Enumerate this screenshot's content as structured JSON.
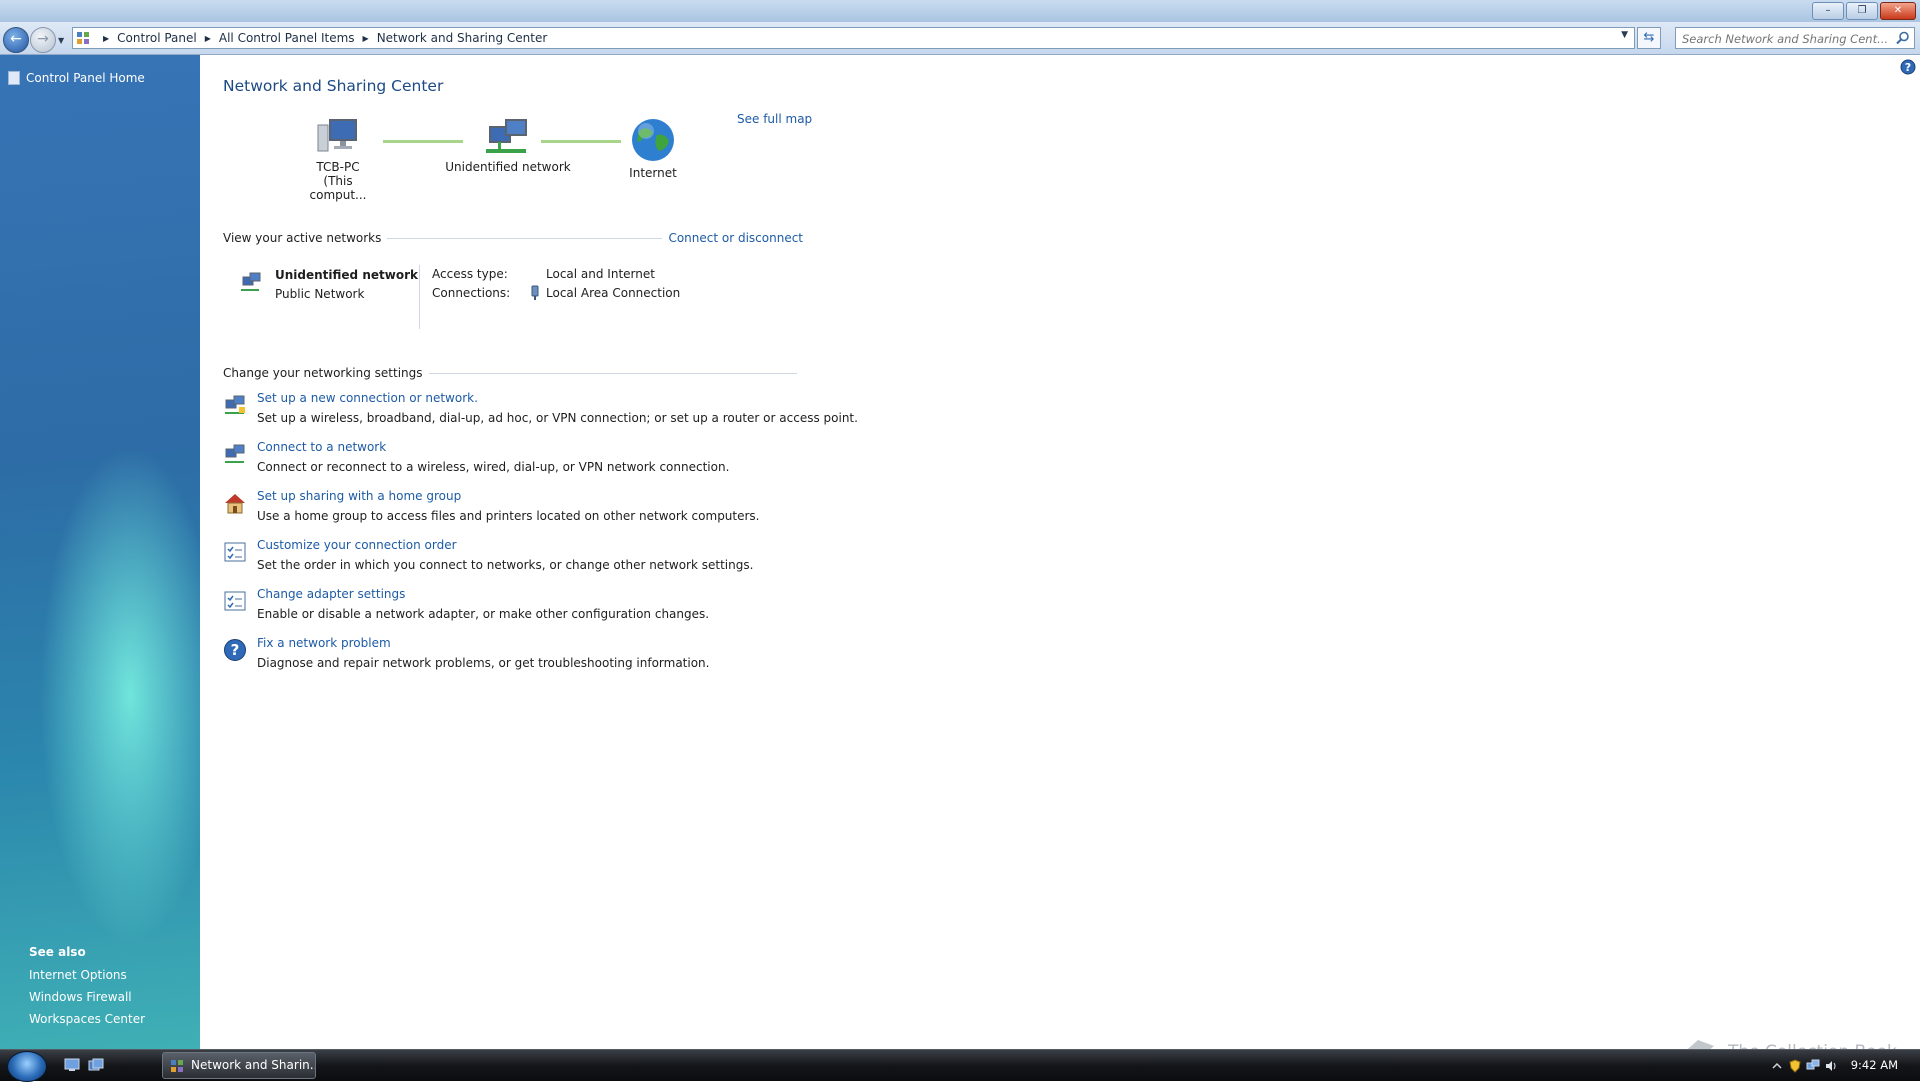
{
  "window": {
    "controls": {
      "minimize": "–",
      "maximize": "❐",
      "close": "✕"
    }
  },
  "navigation": {
    "back_glyph": "←",
    "forward_glyph": "→",
    "breadcrumbs": [
      "Control Panel",
      "All Control Panel Items",
      "Network and Sharing Center"
    ],
    "search_placeholder": "Search Network and Sharing Cent...",
    "refresh_glyph": "⇆"
  },
  "sidebar": {
    "home_label": "Control Panel Home",
    "see_also_title": "See also",
    "see_also_links": [
      "Internet Options",
      "Windows Firewall",
      "Workspaces Center"
    ]
  },
  "main": {
    "title": "Network and Sharing Center",
    "see_full_map": "See full map",
    "map": {
      "computer_name": "TCB-PC",
      "computer_sub": "(This comput...",
      "network_label": "Unidentified network",
      "internet_label": "Internet"
    },
    "active_networks": {
      "heading": "View your active networks",
      "connect_link": "Connect or disconnect",
      "name": "Unidentified network",
      "type": "Public Network",
      "access_label": "Access type:",
      "access_value": "Local and Internet",
      "connections_label": "Connections:",
      "connections_value": "Local Area Connection"
    },
    "settings": {
      "heading": "Change your networking settings",
      "tasks": [
        {
          "link": "Set up a new connection or network.",
          "desc": "Set up a wireless, broadband, dial-up, ad hoc, or VPN connection; or set up a router or access point.",
          "icon": "network-computers-icon"
        },
        {
          "link": "Connect to a network",
          "desc": "Connect or reconnect to a wireless, wired, dial-up, or VPN network connection.",
          "icon": "network-computers-icon"
        },
        {
          "link": "Set up sharing with a home group",
          "desc": "Use a home group to access files and printers located on other network computers.",
          "icon": "home-group-icon"
        },
        {
          "link": "Customize your connection order",
          "desc": "Set the order in which you connect to networks, or change other network settings.",
          "icon": "checklist-icon"
        },
        {
          "link": "Change adapter settings",
          "desc": "Enable or disable a network adapter, or make other configuration changes.",
          "icon": "checklist-icon"
        },
        {
          "link": "Fix a network problem",
          "desc": "Diagnose and repair network problems, or get troubleshooting information.",
          "icon": "help-question-icon"
        }
      ]
    }
  },
  "taskbar": {
    "active_window": "Network and Sharin...",
    "clock": "9:42 AM"
  },
  "watermark": "The Collection Book",
  "colors": {
    "link": "#1d5ba5",
    "title": "#1c4a85"
  }
}
